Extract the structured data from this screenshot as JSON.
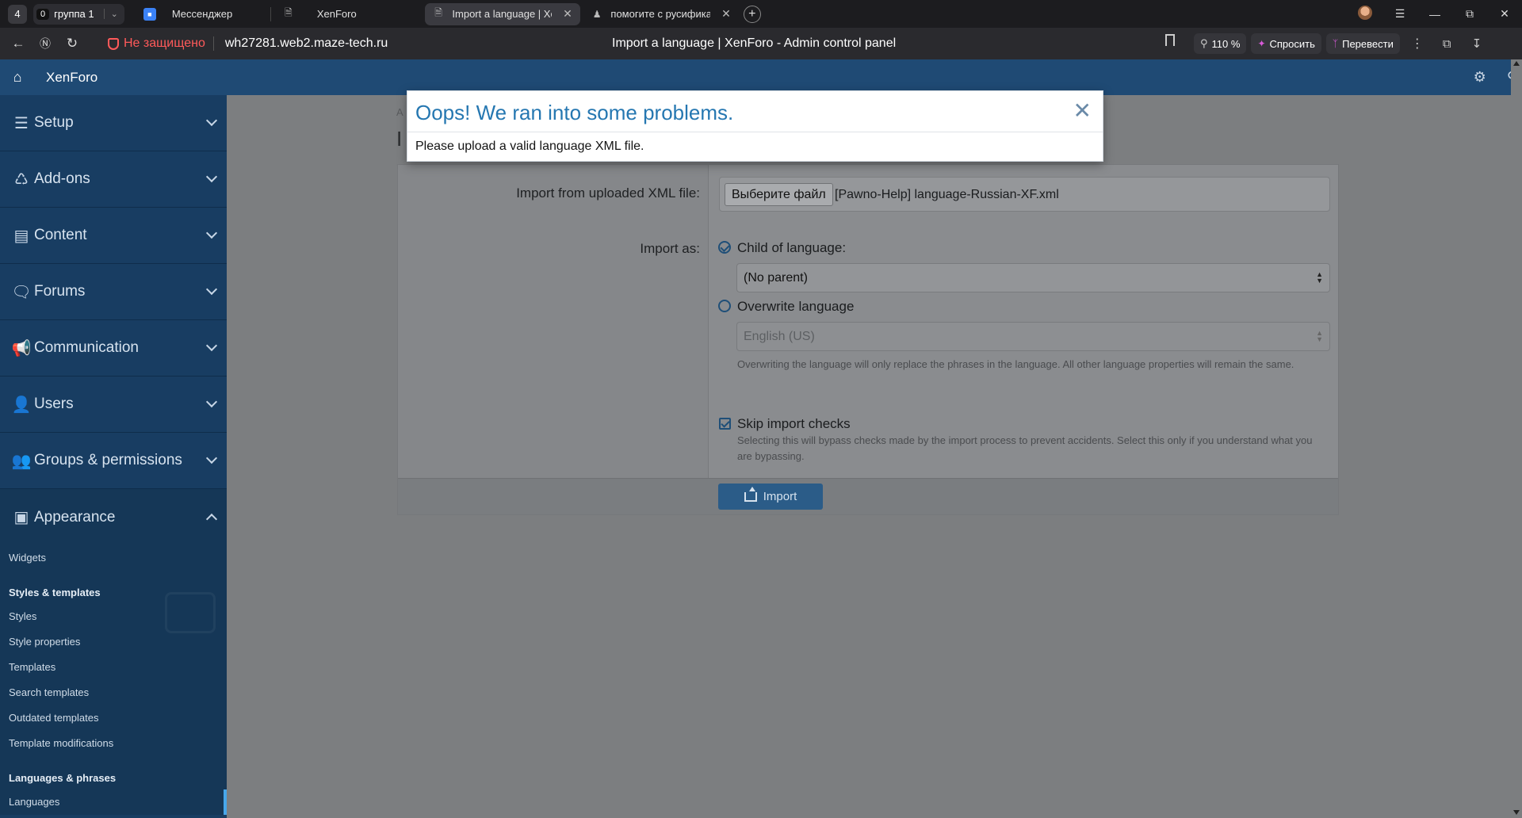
{
  "browser": {
    "tab_count": "4",
    "group": {
      "badge": "0",
      "name": "группа 1"
    },
    "tabs": [
      {
        "label": "Мессенджер",
        "icon": "messenger-icon"
      },
      {
        "label": "XenForo",
        "icon": "page-icon"
      },
      {
        "label": "Import a language | XenForo - Admin control panel",
        "short": "Import a language | Xen",
        "icon": "page-icon",
        "active": true
      },
      {
        "label": "помогите с русификацией",
        "short": "помогите с русификат",
        "icon": "xenforo-icon"
      }
    ],
    "insecure_label": "Не защищено",
    "url": "wh27281.web2.maze-tech.ru",
    "page_title": "Import a language | XenForo - Admin control panel",
    "zoom": "110 %",
    "ask_label": "Спросить",
    "translate_label": "Перевести"
  },
  "admin": {
    "brand": "XenForo",
    "sidebar": {
      "sections": [
        {
          "label": "Setup",
          "icon": "sliders-icon"
        },
        {
          "label": "Add-ons",
          "icon": "puzzle-icon"
        },
        {
          "label": "Content",
          "icon": "newspaper-icon"
        },
        {
          "label": "Forums",
          "icon": "comments-icon"
        },
        {
          "label": "Communication",
          "icon": "megaphone-icon"
        },
        {
          "label": "Users",
          "icon": "user-icon"
        },
        {
          "label": "Groups & permissions",
          "icon": "users-icon"
        },
        {
          "label": "Appearance",
          "icon": "image-icon",
          "open": true
        }
      ],
      "appearance_items": {
        "widgets": "Widgets",
        "styles_head": "Styles & templates",
        "styles": "Styles",
        "style_properties": "Style properties",
        "templates": "Templates",
        "search_templates": "Search templates",
        "outdated_templates": "Outdated templates",
        "template_modifications": "Template modifications",
        "languages_head": "Languages & phrases",
        "languages": "Languages"
      }
    },
    "page": {
      "breadcrumb_fragment": "A",
      "title_fragment": "I",
      "form": {
        "file_label": "Import from uploaded XML file:",
        "file_button": "Выберите файл",
        "file_name": "[Pawno-Help] language-Russian-XF.xml",
        "import_as_label": "Import as:",
        "child_option": "Child of language:",
        "parent_select": "(No parent)",
        "overwrite_option": "Overwrite language",
        "overwrite_select": "English (US)",
        "overwrite_hint": "Overwriting the language will only replace the phrases in the language. All other language properties will remain the same.",
        "skip_checks_label": "Skip import checks",
        "skip_checks_hint": "Selecting this will bypass checks made by the import process to prevent accidents. Select this only if you understand what you are bypassing.",
        "submit_label": "Import"
      }
    },
    "error_overlay": {
      "title": "Oops! We ran into some problems.",
      "message": "Please upload a valid language XML file."
    }
  }
}
